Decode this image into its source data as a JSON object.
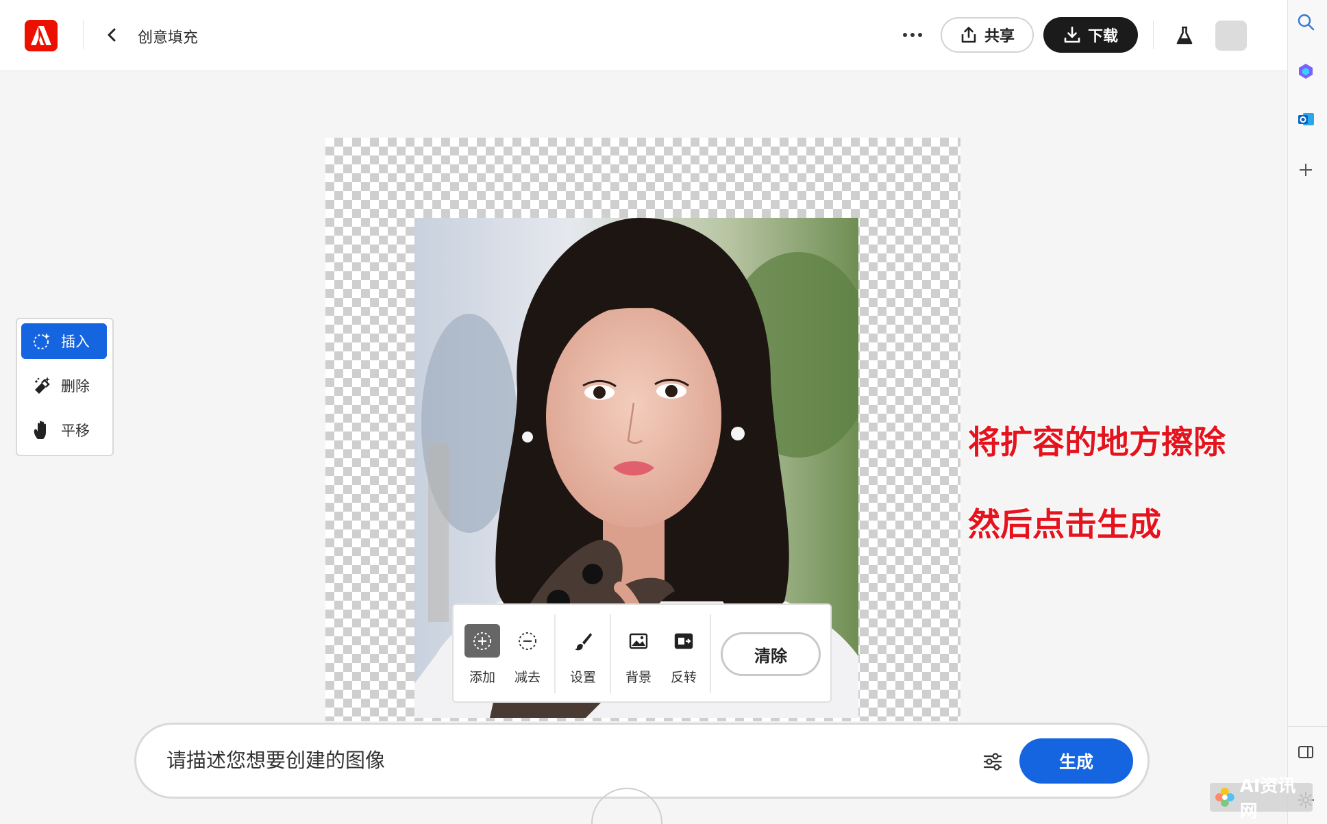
{
  "header": {
    "title": "创意填充",
    "share_label": "共享",
    "download_label": "下载"
  },
  "tools": {
    "items": [
      {
        "label": "插入",
        "icon": "insert-sparkle-icon",
        "active": true
      },
      {
        "label": "删除",
        "icon": "remove-eraser-icon",
        "active": false
      },
      {
        "label": "平移",
        "icon": "hand-pan-icon",
        "active": false
      }
    ]
  },
  "selection_toolbar": {
    "add_label": "添加",
    "subtract_label": "减去",
    "settings_label": "设置",
    "background_label": "背景",
    "invert_label": "反转",
    "clear_label": "清除"
  },
  "prompt": {
    "placeholder": "请描述您想要创建的图像",
    "generate_label": "生成"
  },
  "annotations": {
    "line1": "将扩容的地方擦除",
    "line2": "然后点击生成"
  },
  "watermark": {
    "text": "AI资讯网"
  },
  "colors": {
    "brand_red": "#eb1000",
    "accent_blue": "#1565e0",
    "annotation_red": "#e5131d",
    "download_bg": "#1b1b1b"
  }
}
